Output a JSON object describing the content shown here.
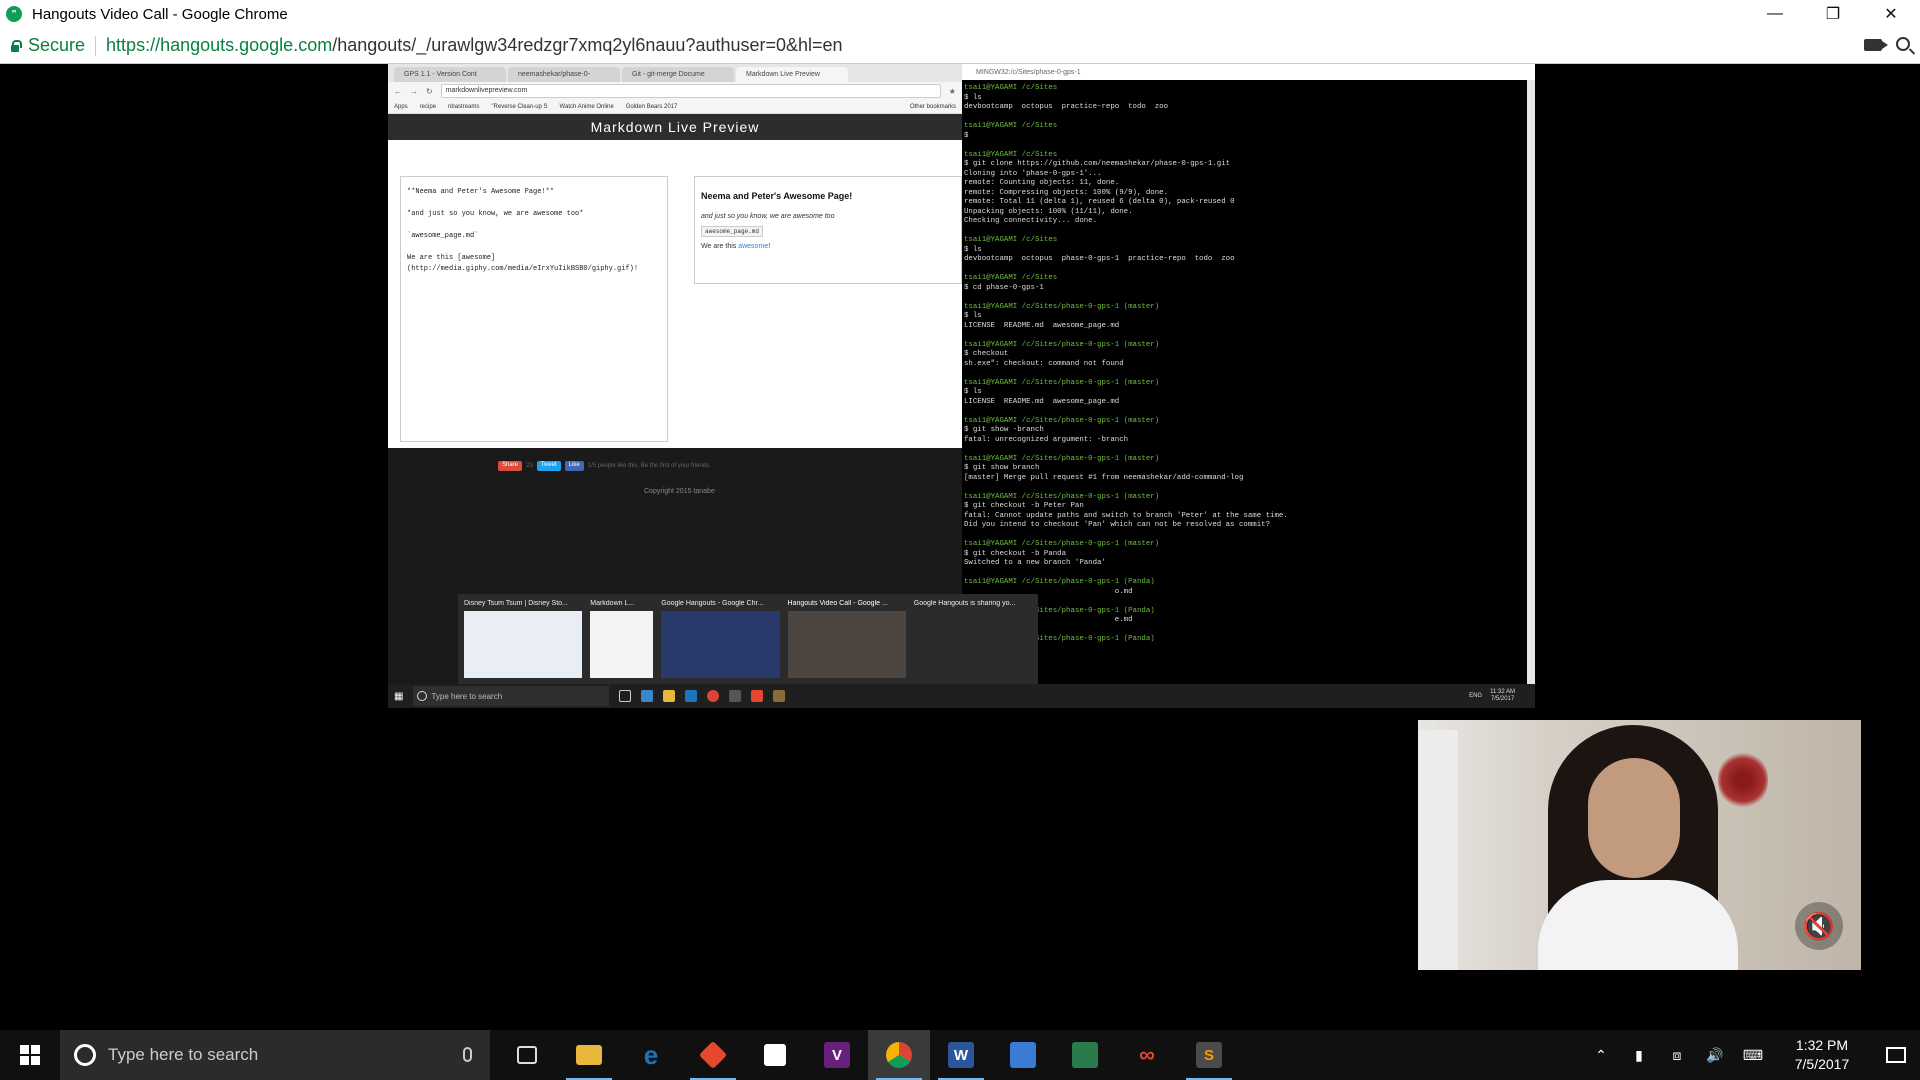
{
  "window": {
    "title": "Hangouts Video Call - Google Chrome",
    "secure_label": "Secure",
    "url_host": "https://hangouts.google.com",
    "url_rest": "/hangouts/_/urawlgw34redzgr7xmq2yl6nauu?authuser=0&hl=en"
  },
  "shared_screen": {
    "browser": {
      "tabs": [
        {
          "label": "GPS 1.1 - Version Cont"
        },
        {
          "label": "neemashekar/phase-0-"
        },
        {
          "label": "Git - git-merge Docume"
        },
        {
          "label": "Markdown Live Preview"
        }
      ],
      "url": "markdownlivepreview.com",
      "bookmarks": [
        "Apps",
        "recipe",
        "nbastreams",
        "\"Reverse Clean-up S",
        "Watch Anime Online",
        "Golden Bears 2017",
        "Other bookmarks"
      ],
      "page_title": "Markdown Live Preview",
      "editor_lines": [
        "**Neema and Peter's Awesome Page!**",
        "*and just so you know, we are awesome too*",
        "`awesome_page.md`",
        "We are this [awesome] (http://media.giphy.com/media/eIrxYuIikBSB0/giphy.gif)!"
      ],
      "preview": {
        "heading": "Neema and Peter's Awesome Page!",
        "italic": "and just so you know, we are awesome too",
        "code": "awesome_page.md",
        "line_prefix": "We are this ",
        "link": "awesome",
        "line_suffix": "!"
      },
      "share": {
        "share_label": "Share",
        "share_count": "23",
        "tweet_label": "Tweet",
        "like_label": "Like",
        "like_text": "1/5 people like this. Be the first of your friends."
      },
      "copyright": "Copyright 2015 tanabe"
    },
    "terminal": {
      "title": "MINGW32:/c/Sites/phase-0-gps-1",
      "lines": [
        {
          "t": "tsai1@YAGAMI /c/Sites",
          "c": "p"
        },
        {
          "t": "$ ls",
          "c": ""
        },
        {
          "t": "devbootcamp  octopus  practice-repo  todo  zoo",
          "c": ""
        },
        {
          "t": "",
          "c": ""
        },
        {
          "t": "tsai1@YAGAMI /c/Sites",
          "c": "p"
        },
        {
          "t": "$",
          "c": ""
        },
        {
          "t": "",
          "c": ""
        },
        {
          "t": "tsai1@YAGAMI /c/Sites",
          "c": "p"
        },
        {
          "t": "$ git clone https://github.com/neemashekar/phase-0-gps-1.git",
          "c": ""
        },
        {
          "t": "Cloning into 'phase-0-gps-1'...",
          "c": ""
        },
        {
          "t": "remote: Counting objects: 11, done.",
          "c": ""
        },
        {
          "t": "remote: Compressing objects: 100% (9/9), done.",
          "c": ""
        },
        {
          "t": "remote: Total 11 (delta 1), reused 6 (delta 0), pack-reused 0",
          "c": ""
        },
        {
          "t": "Unpacking objects: 100% (11/11), done.",
          "c": ""
        },
        {
          "t": "Checking connectivity... done.",
          "c": ""
        },
        {
          "t": "",
          "c": ""
        },
        {
          "t": "tsai1@YAGAMI /c/Sites",
          "c": "p"
        },
        {
          "t": "$ ls",
          "c": ""
        },
        {
          "t": "devbootcamp  octopus  phase-0-gps-1  practice-repo  todo  zoo",
          "c": ""
        },
        {
          "t": "",
          "c": ""
        },
        {
          "t": "tsai1@YAGAMI /c/Sites",
          "c": "p"
        },
        {
          "t": "$ cd phase-0-gps-1",
          "c": ""
        },
        {
          "t": "",
          "c": ""
        },
        {
          "t": "tsai1@YAGAMI /c/Sites/phase-0-gps-1 (master)",
          "c": "p"
        },
        {
          "t": "$ ls",
          "c": ""
        },
        {
          "t": "LICENSE  README.md  awesome_page.md",
          "c": ""
        },
        {
          "t": "",
          "c": ""
        },
        {
          "t": "tsai1@YAGAMI /c/Sites/phase-0-gps-1 (master)",
          "c": "p"
        },
        {
          "t": "$ checkout",
          "c": ""
        },
        {
          "t": "sh.exe\": checkout: command not found",
          "c": ""
        },
        {
          "t": "",
          "c": ""
        },
        {
          "t": "tsai1@YAGAMI /c/Sites/phase-0-gps-1 (master)",
          "c": "p"
        },
        {
          "t": "$ ls",
          "c": ""
        },
        {
          "t": "LICENSE  README.md  awesome_page.md",
          "c": ""
        },
        {
          "t": "",
          "c": ""
        },
        {
          "t": "tsai1@YAGAMI /c/Sites/phase-0-gps-1 (master)",
          "c": "p"
        },
        {
          "t": "$ git show -branch",
          "c": ""
        },
        {
          "t": "fatal: unrecognized argument: -branch",
          "c": ""
        },
        {
          "t": "",
          "c": ""
        },
        {
          "t": "tsai1@YAGAMI /c/Sites/phase-0-gps-1 (master)",
          "c": "p"
        },
        {
          "t": "$ git show branch",
          "c": ""
        },
        {
          "t": "[master] Merge pull request #1 from neemashekar/add-command-log",
          "c": ""
        },
        {
          "t": "",
          "c": ""
        },
        {
          "t": "tsai1@YAGAMI /c/Sites/phase-0-gps-1 (master)",
          "c": "p"
        },
        {
          "t": "$ git checkout -b Peter Pan",
          "c": ""
        },
        {
          "t": "fatal: Cannot update paths and switch to branch 'Peter' at the same time.",
          "c": ""
        },
        {
          "t": "Did you intend to checkout 'Pan' which can not be resolved as commit?",
          "c": ""
        },
        {
          "t": "",
          "c": ""
        },
        {
          "t": "tsai1@YAGAMI /c/Sites/phase-0-gps-1 (master)",
          "c": "p"
        },
        {
          "t": "$ git checkout -b Panda",
          "c": ""
        },
        {
          "t": "Switched to a new branch 'Panda'",
          "c": ""
        },
        {
          "t": "",
          "c": ""
        },
        {
          "t": "tsai1@YAGAMI /c/Sites/phase-0-gps-1 (Panda)",
          "c": "p"
        },
        {
          "t": "                                  o.md",
          "c": ""
        },
        {
          "t": "",
          "c": ""
        },
        {
          "t": "tsai1@YAGAMI /c/Sites/phase-0-gps-1 (Panda)",
          "c": "p"
        },
        {
          "t": "                                  e.md",
          "c": ""
        },
        {
          "t": "",
          "c": ""
        },
        {
          "t": "tsai1@YAGAMI /c/Sites/phase-0-gps-1 (Panda)",
          "c": "p"
        }
      ]
    },
    "thumbnails": [
      {
        "label": "Disney Tsum Tsum | Disney Sto..."
      },
      {
        "label": "Markdown L..."
      },
      {
        "label": "Google Hangouts - Google Chr..."
      },
      {
        "label": "Hangouts Video Call - Google ..."
      },
      {
        "label": "Google Hangouts is sharing yo..."
      }
    ],
    "taskbar": {
      "search_placeholder": "Type here to search",
      "lang": "ENG",
      "time": "11:32 AM",
      "date": "7/5/2017"
    }
  },
  "taskbar": {
    "search_placeholder": "Type here to search",
    "time": "1:32 PM",
    "date": "7/5/2017"
  }
}
